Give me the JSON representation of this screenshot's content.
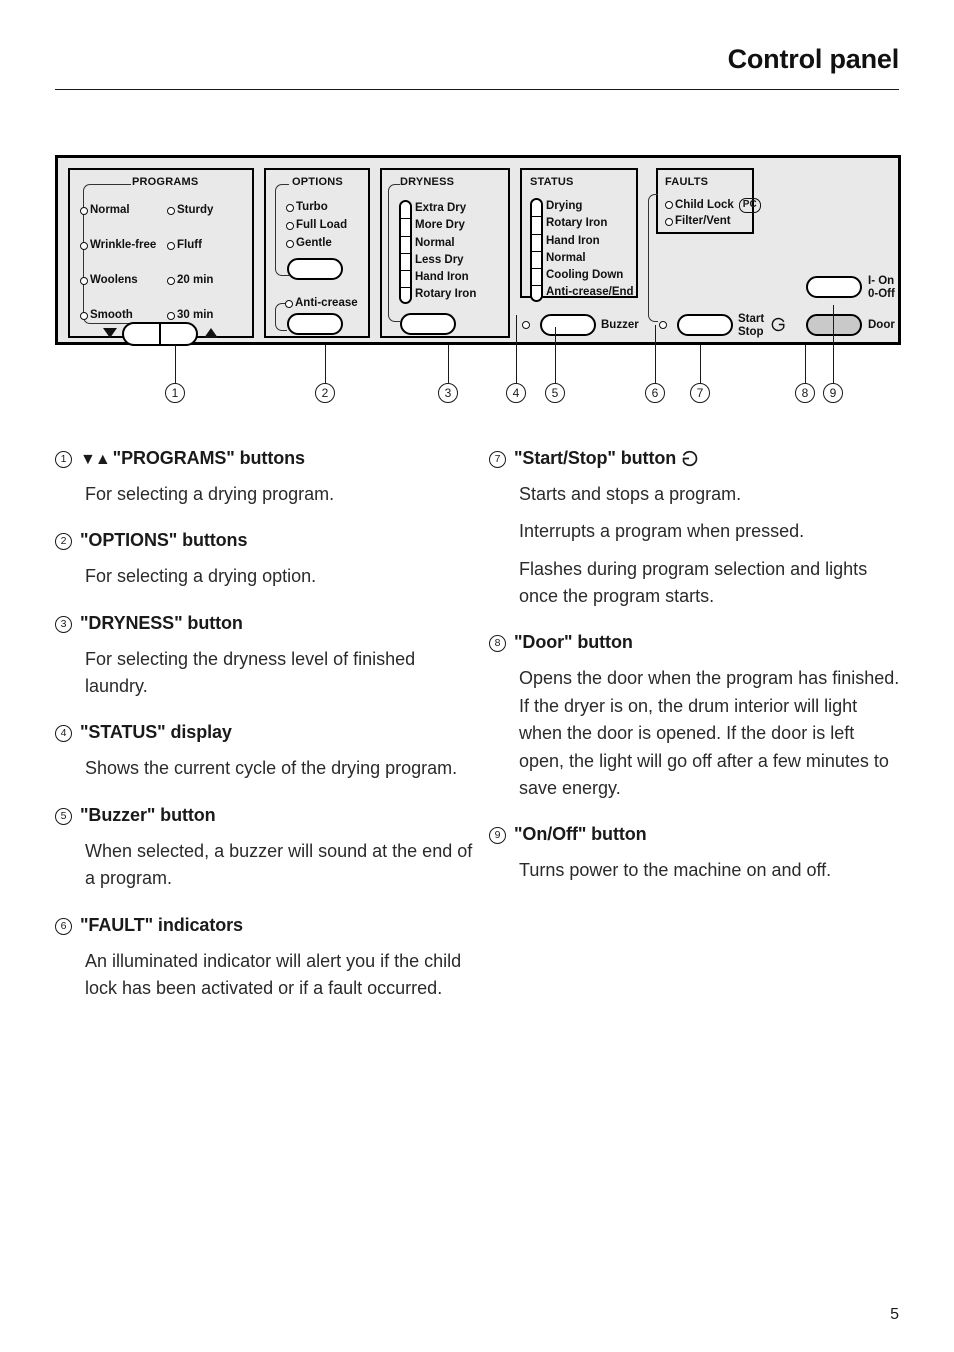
{
  "header": {
    "title": "Control panel"
  },
  "panel": {
    "programs": {
      "title": "PROGRAMS",
      "left_column": [
        "Normal",
        "Wrinkle-free",
        "Woolens",
        "Smooth"
      ],
      "right_column": [
        "Sturdy",
        "Fluff",
        "20 min",
        "30 min"
      ],
      "down_arrow": "▼",
      "up_arrow": "▲"
    },
    "options": {
      "title": "OPTIONS",
      "items": [
        "Turbo",
        "Full Load",
        "Gentle"
      ],
      "anticrease_label": "Anti-crease"
    },
    "dryness": {
      "title": "DRYNESS",
      "levels": [
        "Extra Dry",
        "More Dry",
        "Normal",
        "Less Dry",
        "Hand Iron",
        "Rotary Iron"
      ]
    },
    "status": {
      "title": "STATUS",
      "levels": [
        "Drying",
        "Rotary Iron",
        "Hand Iron",
        "Normal",
        "Cooling Down",
        "Anti-crease/End"
      ],
      "buzzer_label": "Buzzer"
    },
    "faults": {
      "title": "FAULTS",
      "items": [
        "Child Lock",
        "Filter/Vent"
      ],
      "child_lock_badge": "PC"
    },
    "controls": {
      "start_stop_line1": "Start",
      "start_stop_line2": "Stop",
      "start_stop_symbol": "Ꮹ",
      "on_label": "I- On",
      "off_label": "0-Off",
      "door_label": "Door"
    }
  },
  "callouts": {
    "numbers": [
      "1",
      "2",
      "3",
      "4",
      "5",
      "6",
      "7",
      "8",
      "9"
    ]
  },
  "entries": {
    "left": [
      {
        "num": "1",
        "arrows": "▼▲",
        "title": "\"PROGRAMS\" buttons",
        "paragraphs": [
          "For selecting a drying program."
        ]
      },
      {
        "num": "2",
        "arrows": "",
        "title": "\"OPTIONS\" buttons",
        "paragraphs": [
          "For selecting a drying option."
        ]
      },
      {
        "num": "3",
        "arrows": "",
        "title": "\"DRYNESS\" button",
        "paragraphs": [
          "For selecting the dryness level of finished laundry."
        ]
      },
      {
        "num": "4",
        "arrows": "",
        "title": "\"STATUS\" display",
        "paragraphs": [
          "Shows the current cycle of the drying program."
        ]
      },
      {
        "num": "5",
        "arrows": "",
        "title": "\"Buzzer\" button",
        "paragraphs": [
          "When selected, a buzzer will sound at the end of a program."
        ]
      },
      {
        "num": "6",
        "arrows": "",
        "title": "\"FAULT\" indicators",
        "paragraphs": [
          "An illuminated indicator will alert you if the child lock has been activated or if a fault occurred."
        ]
      }
    ],
    "right": [
      {
        "num": "7",
        "arrows": "",
        "title": "\"Start/Stop\" button",
        "symbol": "Ꮹ",
        "paragraphs": [
          "Starts and stops a program.",
          "Interrupts a program when pressed.",
          "Flashes during program selection and lights once the program starts."
        ]
      },
      {
        "num": "8",
        "arrows": "",
        "title": "\"Door\" button",
        "paragraphs": [
          "Opens the door when the program has finished. If the dryer is on, the drum interior will light when the door is opened. If the door is left open, the light will go off after a few minutes to save energy."
        ]
      },
      {
        "num": "9",
        "arrows": "",
        "title": "\"On/Off\" button",
        "paragraphs": [
          "Turns power to the machine on and off."
        ]
      }
    ]
  },
  "footer": {
    "page_number": "5"
  }
}
